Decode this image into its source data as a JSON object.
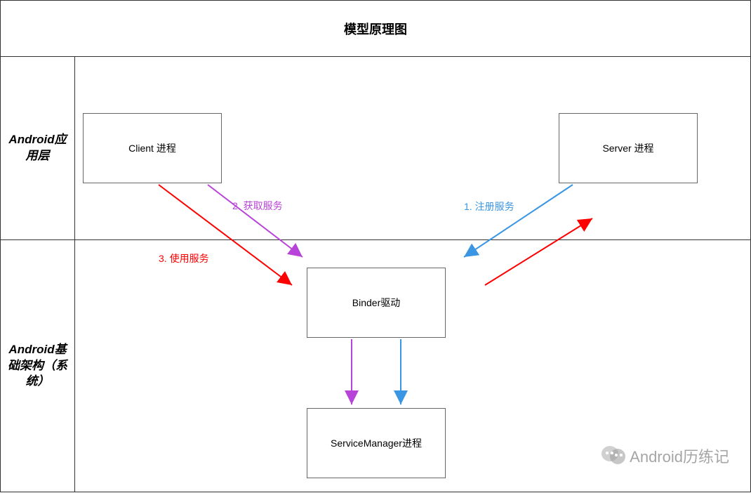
{
  "title": "模型原理图",
  "rows": {
    "app_layer": "Android应用层",
    "base_layer": "Android基础架构（系统）"
  },
  "boxes": {
    "client": "Client 进程",
    "server": "Server 进程",
    "binder": "Binder驱动",
    "service_manager": "ServiceManager进程"
  },
  "edges": {
    "register": "1. 注册服务",
    "acquire": "2. 获取服务",
    "use": "3. 使用服务"
  },
  "colors": {
    "blue": "#3a95e2",
    "purple": "#b843d8",
    "red": "#ff0000"
  },
  "watermark": "Android历练记"
}
